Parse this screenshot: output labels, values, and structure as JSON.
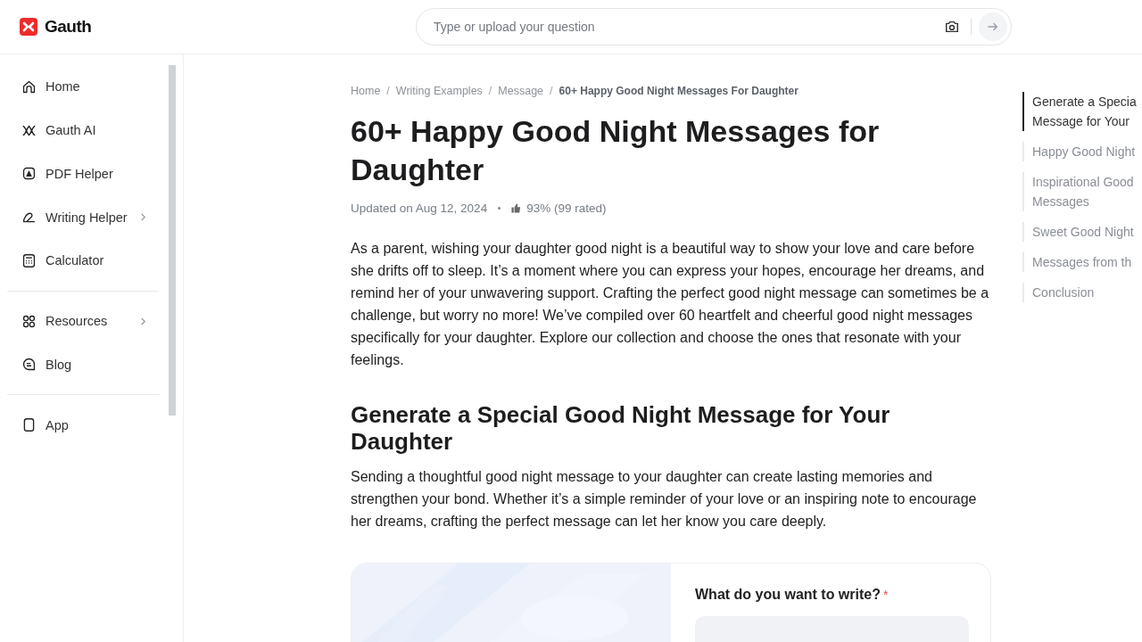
{
  "header": {
    "logo": "Gauth",
    "search": {
      "placeholder": "Type or upload your question"
    }
  },
  "sidebar": {
    "items": [
      {
        "label": "Home",
        "submenu": false
      },
      {
        "label": "Gauth AI",
        "submenu": false
      },
      {
        "label": "PDF Helper",
        "submenu": false
      },
      {
        "label": "Writing Helper",
        "submenu": true
      },
      {
        "label": "Calculator",
        "submenu": false
      },
      {
        "kind": "divider"
      },
      {
        "label": "Resources",
        "submenu": true
      },
      {
        "label": "Blog",
        "submenu": false
      },
      {
        "kind": "divider"
      },
      {
        "label": "App",
        "submenu": false
      }
    ]
  },
  "breadcrumb": [
    {
      "label": "Home",
      "current": false
    },
    {
      "separator": "/"
    },
    {
      "label": "Writing Examples",
      "current": false
    },
    {
      "separator": "/"
    },
    {
      "label": "Message",
      "current": false
    },
    {
      "separator": "/"
    },
    {
      "label": "60+ Happy Good Night Messages For Daughter",
      "current": true
    }
  ],
  "article": {
    "title": "60+ Happy Good Night Messages for Daughter",
    "updated": "Updated on Aug 12, 2024",
    "rating": "93% (99 rated)",
    "intro": "As a parent, wishing your daughter good night is a beautiful way to show your love and care before she drifts off to sleep. It’s a moment where you can express your hopes, encourage her dreams, and remind her of your unwavering support. Crafting the perfect good night message can sometimes be a challenge, but worry no more! We’ve compiled over 60 heartfelt and cheerful good night messages specifically for your daughter. Explore our collection and choose the ones that resonate with your feelings.",
    "section_title": "Generate a Special Good Night Message for Your Daughter",
    "section_text": "Sending a thoughtful good night message to your daughter can create lasting memories and strengthen your bond. Whether it’s a simple reminder of your love or an inspiring note to encourage her dreams, crafting the perfect message can let her know you care deeply.",
    "generator": {
      "kind": "picture",
      "question": "What do you want to write?",
      "required_mark": "*"
    }
  },
  "toc": [
    {
      "lines": [
        "Generate a Specia",
        "Message for Your"
      ],
      "selected": true
    },
    {
      "lines": [
        "Happy Good Night"
      ],
      "selected": false
    },
    {
      "lines": [
        "Inspirational Good",
        "Messages"
      ],
      "selected": false
    },
    {
      "lines": [
        "Sweet Good Night"
      ],
      "selected": false
    },
    {
      "lines": [
        "Messages from th"
      ],
      "selected": false
    },
    {
      "lines": [
        "Conclusion"
      ],
      "selected": false
    }
  ]
}
